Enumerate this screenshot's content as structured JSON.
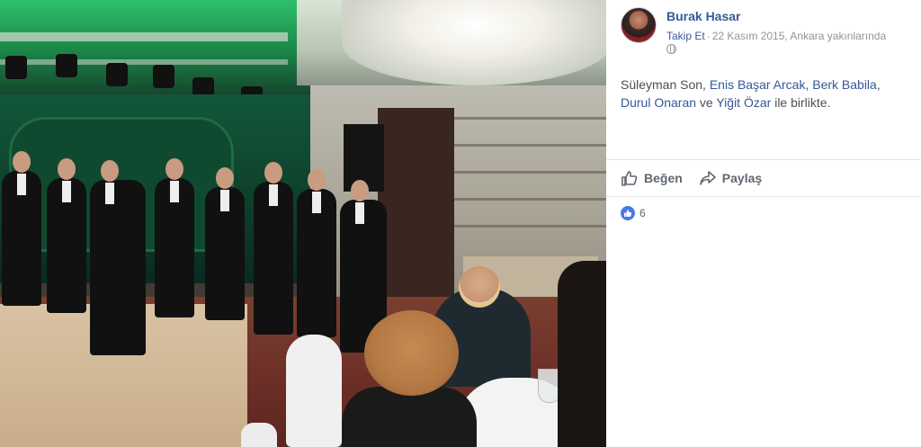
{
  "photo": {
    "alt": ""
  },
  "post": {
    "author": "Burak Hasar",
    "follow": "Takip Et",
    "separator": "·",
    "date": "22 Kasım 2015, Ankara yakınlarında",
    "privacy_icon": "globe-icon",
    "caption": {
      "lead": "Süleyman Son, ",
      "tag1": "Enis Başar Arcak",
      "sep1": ", ",
      "tag2": "Berk Babila",
      "sep2": ",",
      "tag3": "Durul Onaran",
      "connector": " ve ",
      "tag4": "Yiğit Özar",
      "tail": " ile birlikte."
    }
  },
  "actions": {
    "like_label": "Beğen",
    "like_icon": "thumbs-up-icon",
    "share_label": "Paylaş",
    "share_icon": "share-arrow-icon"
  },
  "reactions": {
    "icon": "like-reaction-icon",
    "count": "6"
  },
  "colors": {
    "link": "#365899",
    "meta": "#90949c",
    "text": "#4b4f56",
    "like_badge": "#4a79e4"
  }
}
